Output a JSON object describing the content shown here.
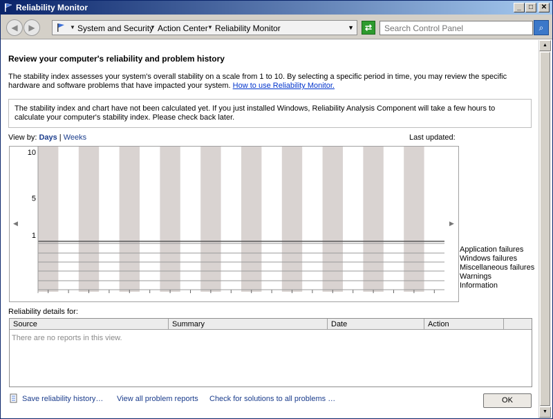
{
  "window": {
    "title": "Reliability Monitor"
  },
  "titlebar_buttons": {
    "minimize": "_",
    "maximize": "□",
    "close": "✕"
  },
  "address": {
    "crumbs": [
      "System and Security",
      "Action Center",
      "Reliability Monitor"
    ],
    "search_placeholder": "Search Control Panel"
  },
  "main": {
    "heading": "Review your computer's reliability and problem history",
    "description": "The stability index assesses your system's overall stability on a scale from 1 to 10. By selecting a specific period in time, you may review the specific hardware and software problems that have impacted your system.",
    "help_link": "How to use Reliability Monitor.",
    "notice": "The stability index and chart have not been calculated yet. If you just installed Windows, Reliability Analysis Component will take a few hours to calculate your computer's stability index. Please check back later.",
    "view_by_label": "View by:",
    "view_days": "Days",
    "view_separator": "|",
    "view_weeks": "Weeks",
    "last_updated_label": "Last updated:"
  },
  "chart_data": {
    "type": "bar",
    "y_ticks": [
      "10",
      "5",
      "1"
    ],
    "ylim": [
      1,
      10
    ],
    "columns": 20,
    "shaded_every_other": true,
    "values": [],
    "legend": [
      "Application failures",
      "Windows failures",
      "Miscellaneous failures",
      "Warnings",
      "Information"
    ],
    "colors": {
      "shade": "#d9d3d1",
      "line": "#555555"
    }
  },
  "details": {
    "label": "Reliability details for:",
    "columns": [
      "Source",
      "Summary",
      "Date",
      "Action"
    ],
    "empty_message": "There are no reports in this view."
  },
  "footer": {
    "save_link": "Save reliability history…",
    "view_reports_link": "View all problem reports",
    "check_solutions_link": "Check for solutions to all problems …",
    "ok_label": "OK"
  }
}
